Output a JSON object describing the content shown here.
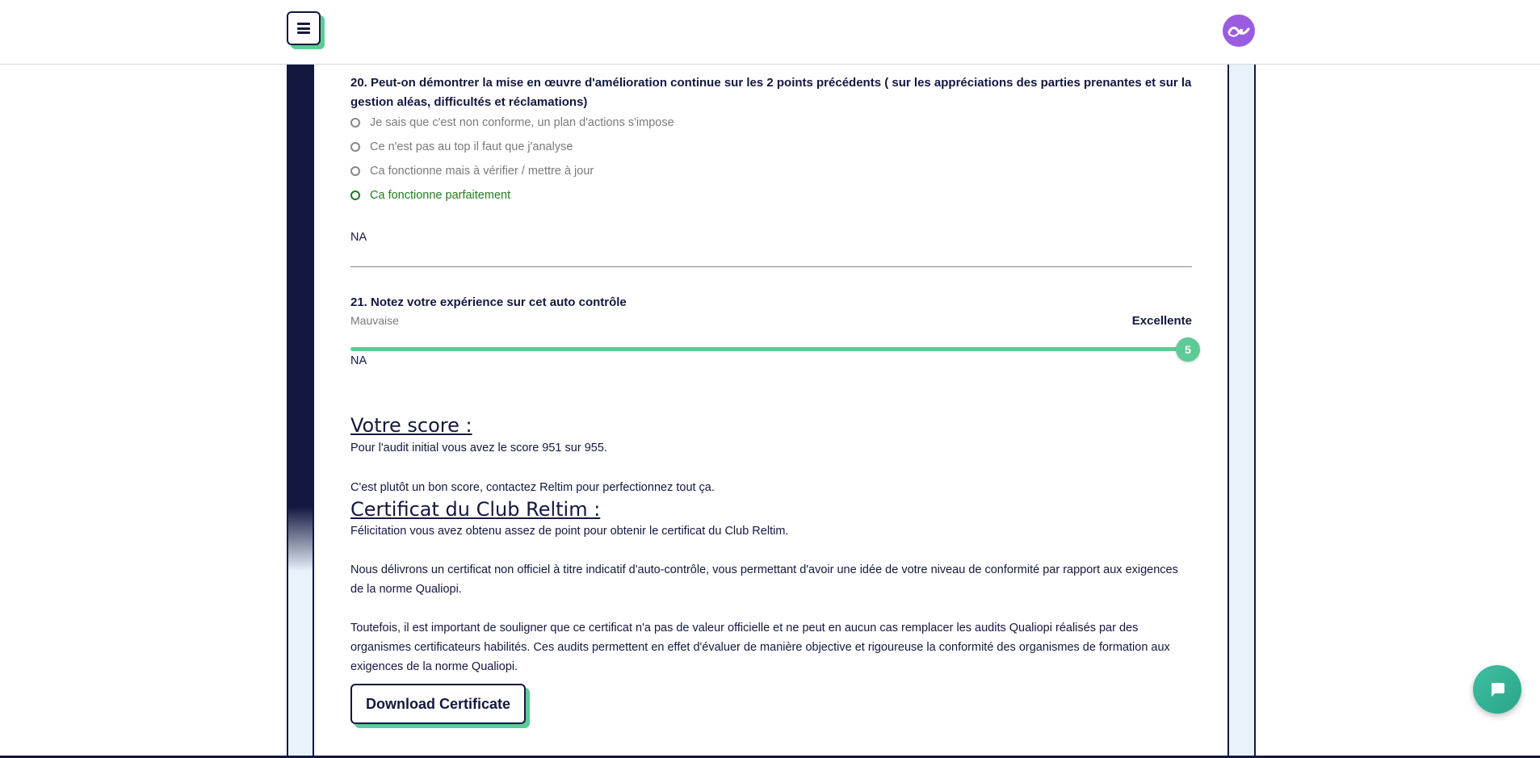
{
  "header": {
    "menu_icon": "hamburger-menu-icon",
    "avatar_icon": "reltim-logo-icon",
    "avatar_color": "#9a5ce0"
  },
  "colors": {
    "navy": "#13183f",
    "accent_green": "#5ecb97",
    "selected_green": "#1e7d1e",
    "muted_gray": "#7a7a7a",
    "strip_light": "#e8f2fb"
  },
  "question20": {
    "title": "20. Peut-on démontrer la mise en œuvre d'amélioration continue sur les 2 points précédents ( sur les appréciations des parties prenantes et sur la gestion aléas, difficultés et réclamations)",
    "options": [
      {
        "label": "Je sais que c'est non conforme, un plan d'actions s'impose",
        "selected": false
      },
      {
        "label": "Ce n'est pas au top il faut que j'analyse",
        "selected": false
      },
      {
        "label": "Ca fonctionne mais à vérifier / mettre à jour",
        "selected": false
      },
      {
        "label": "Ca fonctionne parfaitement",
        "selected": true
      }
    ],
    "na": "NA"
  },
  "question21": {
    "title": "21. Notez votre expérience sur cet auto contrôle",
    "min_label": "Mauvaise",
    "max_label": "Excellente",
    "value": "5",
    "na": "NA"
  },
  "score": {
    "heading": "Votre score :",
    "line1": "Pour l'audit initial vous avez le score 951 sur 955.",
    "line2": "C'est plutôt un bon score, contactez Reltim pour perfectionnez tout ça."
  },
  "certificate": {
    "heading": "Certificat du Club Reltim :",
    "para1": "Félicitation vous avez obtenu assez de point pour obtenir le certificat du Club Reltim.",
    "para2": "Nous délivrons un certificat non officiel à titre indicatif d'auto-contrôle, vous permettant d'avoir une idée de votre niveau de conformité par rapport aux exigences de la norme Qualiopi.",
    "para3": "Toutefois, il est important de souligner que ce certificat n'a pas de valeur officielle et ne peut en aucun cas remplacer les audits Qualiopi réalisés par des organismes certificateurs habilités. Ces audits permettent en effet d'évaluer de manière objective et rigoureuse la conformité des organismes de formation aux exigences de la norme Qualiopi.",
    "button": "Download Certificate"
  },
  "chat": {
    "icon": "chat-bubble-icon"
  }
}
